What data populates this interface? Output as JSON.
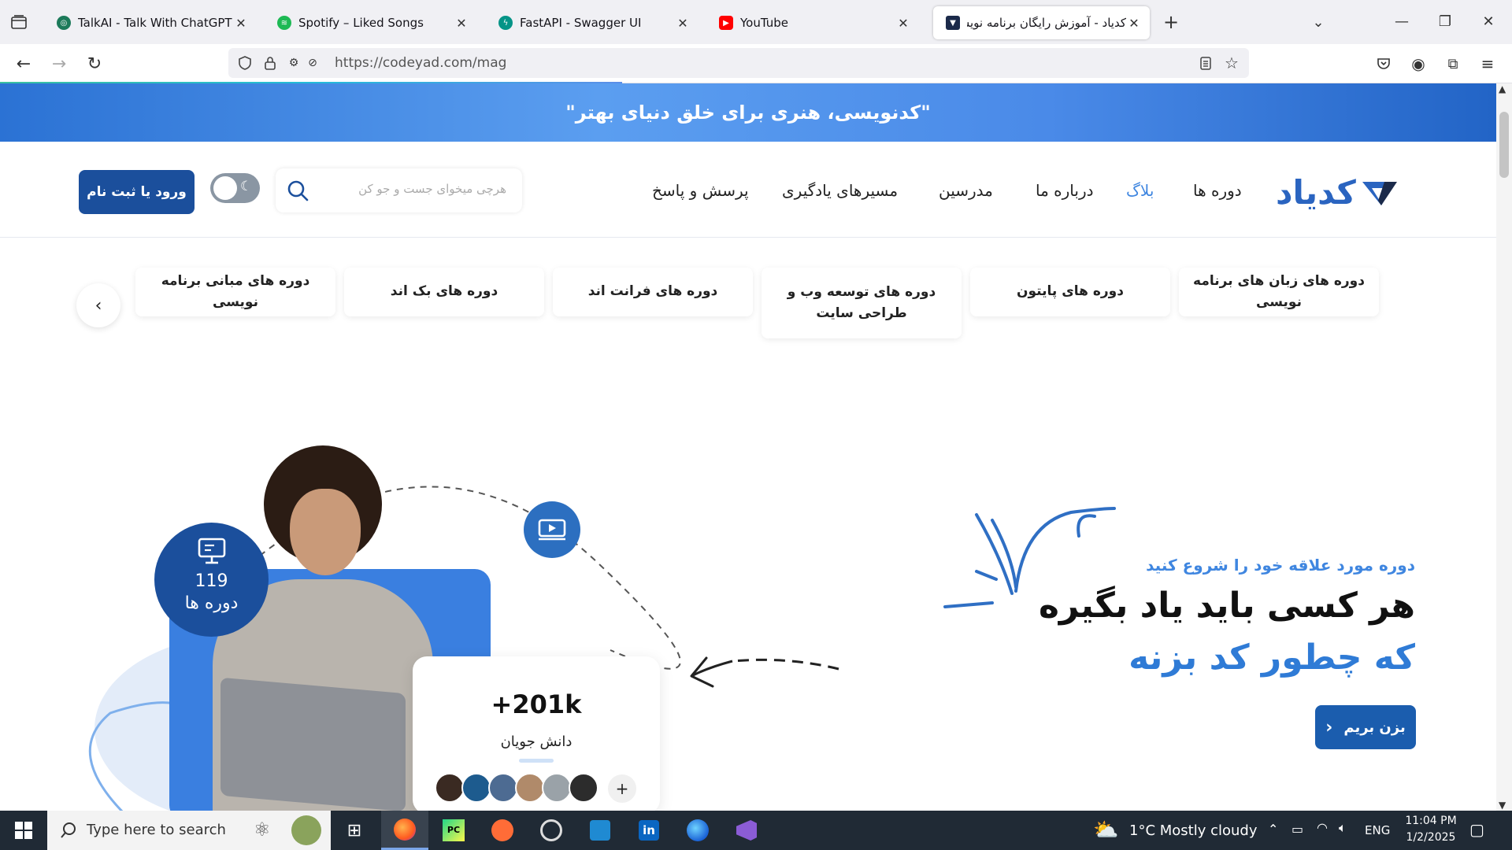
{
  "browser": {
    "tabs": [
      {
        "title": "TalkAI - Talk With ChatGPT",
        "active": false
      },
      {
        "title": "Spotify – Liked Songs",
        "active": false
      },
      {
        "title": "FastAPI - Swagger UI",
        "active": false
      },
      {
        "title": "YouTube",
        "active": false
      },
      {
        "title": "کدیاد - آموزش رایگان برنامه نویسی",
        "active": true
      }
    ],
    "url": "https://codeyad.com/mag"
  },
  "banner": {
    "text": "\"کدنویسی، هنری برای خلق دنیای بهتر\""
  },
  "header": {
    "logo": "کدیاد",
    "nav": [
      {
        "label": "دوره ها"
      },
      {
        "label": "بلاگ",
        "active": true
      },
      {
        "label": "درباره ما"
      },
      {
        "label": "مدرسین"
      },
      {
        "label": "مسیرهای یادگیری"
      },
      {
        "label": "پرسش و پاسخ"
      }
    ],
    "search_placeholder": "هرچی میخوای جست و جو کن",
    "login_label": "ورود یا ثبت نام"
  },
  "categories": [
    "دوره های زبان های برنامه نویسی",
    "دوره های پایتون",
    "دوره های توسعه وب و طراحی سایت",
    "دوره های فرانت اند",
    "دوره های بک اند",
    "دوره های مبانی برنامه نویسی"
  ],
  "hero": {
    "subtitle": "دوره مورد علاقه خود را شروع کنید",
    "title_line1": "هر کسی باید یاد بگیره",
    "title_line2": "که چطور کد بزنه",
    "cta_label": "بزن بریم",
    "courses_count": "119",
    "courses_label": "دوره ها",
    "students_count": "+201k",
    "students_label": "دانش جویان",
    "more_symbol": "+"
  },
  "colors": {
    "brand_primary": "#1b4f9c",
    "brand_accent": "#3f86e0"
  },
  "taskbar": {
    "search_placeholder": "Type here to search",
    "weather": "1°C  Mostly cloudy",
    "lang": "ENG",
    "time": "11:04 PM",
    "date": "1/2/2025"
  }
}
